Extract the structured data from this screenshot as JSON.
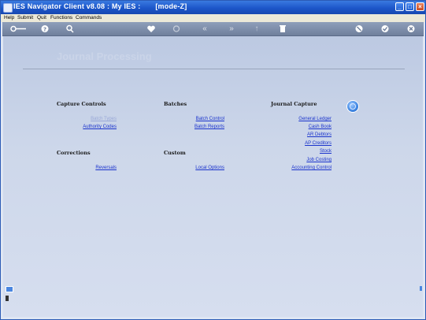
{
  "window": {
    "title": "IES Navigator Client v8.08 : My IES :       [mode-Z]"
  },
  "menubar": {
    "items": [
      "Help",
      "Submit",
      "Quit",
      "Functions",
      "Commands"
    ]
  },
  "toolbar": {
    "icons": [
      "key-icon",
      "help-icon",
      "search-icon",
      "heart-icon",
      "refresh-icon",
      "rewind-icon",
      "forward-icon",
      "up-icon",
      "delete-icon",
      "cancel-icon",
      "ok-icon",
      "exit-icon"
    ]
  },
  "page": {
    "title": "Journal Processing"
  },
  "sections": {
    "capture_controls": {
      "heading": "Capture Controls",
      "links": [
        "Batch Types",
        "Authority Codes"
      ]
    },
    "batches": {
      "heading": "Batches",
      "links": [
        "Batch Control",
        "Batch Reports"
      ]
    },
    "journal_capture": {
      "heading": "Journal Capture",
      "links": [
        "General Ledger",
        "Cash Book",
        "AR Debtors",
        "AP Creditors",
        "Stock",
        "Job Costing",
        "Accounting Control"
      ]
    },
    "corrections": {
      "heading": "Corrections",
      "links": [
        "Reversals"
      ]
    },
    "custom": {
      "heading": "Custom",
      "links": [
        "Local Options"
      ]
    }
  },
  "colors": {
    "link": "#1a33cc",
    "link_disabled": "#9aa8d8",
    "titlebar": "#1c56c9"
  }
}
